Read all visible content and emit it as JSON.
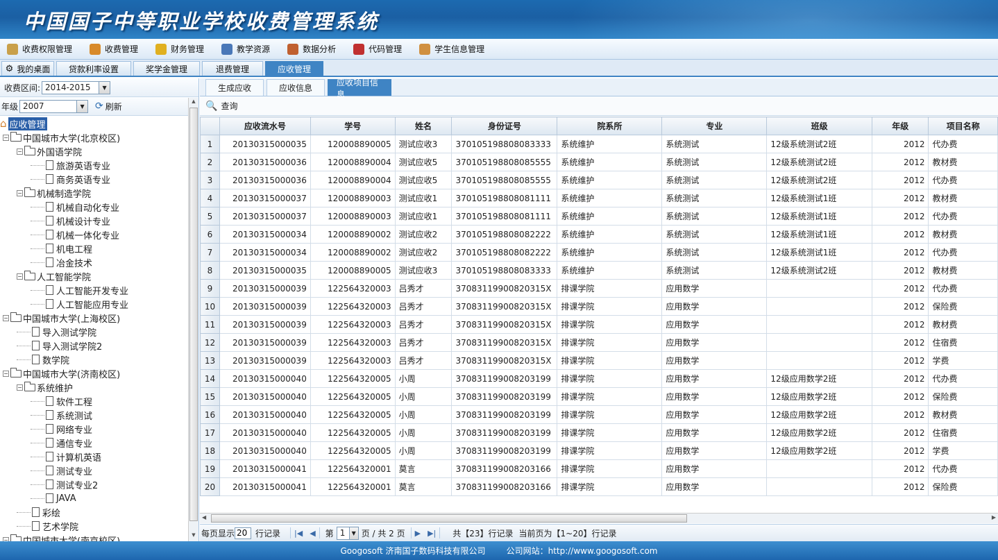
{
  "app_title": "中国国子中等职业学校收费管理系统",
  "menu": [
    {
      "label": "收费权限管理",
      "icon": "permission-icon",
      "color": "#c9a04a"
    },
    {
      "label": "收费管理",
      "icon": "fee-icon",
      "color": "#d88a2a"
    },
    {
      "label": "财务管理",
      "icon": "finance-icon",
      "color": "#e0b020"
    },
    {
      "label": "教学资源",
      "icon": "teaching-icon",
      "color": "#4a78b8"
    },
    {
      "label": "数据分析",
      "icon": "analysis-icon",
      "color": "#c06030"
    },
    {
      "label": "代码管理",
      "icon": "code-icon",
      "color": "#c03030"
    },
    {
      "label": "学生信息管理",
      "icon": "student-icon",
      "color": "#d09040"
    }
  ],
  "tabs": {
    "home": "我的桌面",
    "items": [
      "贷款利率设置",
      "奖学金管理",
      "退费管理",
      "应收管理"
    ]
  },
  "left": {
    "term_label": "收费区间:",
    "term_value": "2014-2015",
    "grade_label": "年级",
    "grade_value": "2007",
    "refresh_label": "刷新",
    "tree": [
      {
        "level": 0,
        "type": "root",
        "label": "应收管理"
      },
      {
        "level": 0,
        "type": "folder",
        "label": "中国城市大学(北京校区)"
      },
      {
        "level": 1,
        "type": "folder",
        "label": "外国语学院"
      },
      {
        "level": 2,
        "type": "leaf",
        "label": "旅游英语专业"
      },
      {
        "level": 2,
        "type": "leaf",
        "label": "商务英语专业"
      },
      {
        "level": 1,
        "type": "folder",
        "label": "机械制造学院"
      },
      {
        "level": 2,
        "type": "leaf",
        "label": "机械自动化专业"
      },
      {
        "level": 2,
        "type": "leaf",
        "label": "机械设计专业"
      },
      {
        "level": 2,
        "type": "leaf",
        "label": "机械一体化专业"
      },
      {
        "level": 2,
        "type": "leaf",
        "label": "机电工程"
      },
      {
        "level": 2,
        "type": "leaf",
        "label": "冶金技术"
      },
      {
        "level": 1,
        "type": "folder",
        "label": "人工智能学院"
      },
      {
        "level": 2,
        "type": "leaf",
        "label": "人工智能开发专业"
      },
      {
        "level": 2,
        "type": "leaf",
        "label": "人工智能应用专业"
      },
      {
        "level": 0,
        "type": "folder",
        "label": "中国城市大学(上海校区)"
      },
      {
        "level": 1,
        "type": "leaf",
        "label": "导入测试学院"
      },
      {
        "level": 1,
        "type": "leaf",
        "label": "导入测试学院2"
      },
      {
        "level": 1,
        "type": "leaf",
        "label": "数学院"
      },
      {
        "level": 0,
        "type": "folder",
        "label": "中国城市大学(济南校区)"
      },
      {
        "level": 1,
        "type": "folder",
        "label": "系统维护"
      },
      {
        "level": 2,
        "type": "leaf",
        "label": "软件工程"
      },
      {
        "level": 2,
        "type": "leaf",
        "label": "系统测试"
      },
      {
        "level": 2,
        "type": "leaf",
        "label": "网络专业"
      },
      {
        "level": 2,
        "type": "leaf",
        "label": "通信专业"
      },
      {
        "level": 2,
        "type": "leaf",
        "label": "计算机英语"
      },
      {
        "level": 2,
        "type": "leaf",
        "label": "测试专业"
      },
      {
        "level": 2,
        "type": "leaf",
        "label": "测试专业2"
      },
      {
        "level": 2,
        "type": "leaf",
        "label": "JAVA"
      },
      {
        "level": 1,
        "type": "leaf",
        "label": "彩绘"
      },
      {
        "level": 1,
        "type": "leaf",
        "label": "艺术学院"
      },
      {
        "level": 0,
        "type": "folder",
        "label": "中国城市大学(南京校区)"
      }
    ]
  },
  "subtabs": [
    "生成应收",
    "应收信息",
    "应收项目信息"
  ],
  "query_label": "查询",
  "table": {
    "columns": [
      "应收流水号",
      "学号",
      "姓名",
      "身份证号",
      "院系所",
      "专业",
      "班级",
      "年级",
      "项目名称"
    ],
    "rows": [
      [
        "1",
        "20130315000035",
        "120008890005",
        "测试应收3",
        "370105198808083333",
        "系统维护",
        "系统测试",
        "12级系统测试2班",
        "2012",
        "代办费"
      ],
      [
        "2",
        "20130315000036",
        "120008890004",
        "测试应收5",
        "370105198808085555",
        "系统维护",
        "系统测试",
        "12级系统测试2班",
        "2012",
        "教材费"
      ],
      [
        "3",
        "20130315000036",
        "120008890004",
        "测试应收5",
        "370105198808085555",
        "系统维护",
        "系统测试",
        "12级系统测试2班",
        "2012",
        "代办费"
      ],
      [
        "4",
        "20130315000037",
        "120008890003",
        "测试应收1",
        "370105198808081111",
        "系统维护",
        "系统测试",
        "12级系统测试1班",
        "2012",
        "教材费"
      ],
      [
        "5",
        "20130315000037",
        "120008890003",
        "测试应收1",
        "370105198808081111",
        "系统维护",
        "系统测试",
        "12级系统测试1班",
        "2012",
        "代办费"
      ],
      [
        "6",
        "20130315000034",
        "120008890002",
        "测试应收2",
        "370105198808082222",
        "系统维护",
        "系统测试",
        "12级系统测试1班",
        "2012",
        "教材费"
      ],
      [
        "7",
        "20130315000034",
        "120008890002",
        "测试应收2",
        "370105198808082222",
        "系统维护",
        "系统测试",
        "12级系统测试1班",
        "2012",
        "代办费"
      ],
      [
        "8",
        "20130315000035",
        "120008890005",
        "测试应收3",
        "370105198808083333",
        "系统维护",
        "系统测试",
        "12级系统测试2班",
        "2012",
        "教材费"
      ],
      [
        "9",
        "20130315000039",
        "122564320003",
        "吕秀才",
        "37083119900820315X",
        "排课学院",
        "应用数学",
        "",
        "2012",
        "代办费"
      ],
      [
        "10",
        "20130315000039",
        "122564320003",
        "吕秀才",
        "37083119900820315X",
        "排课学院",
        "应用数学",
        "",
        "2012",
        "保险费"
      ],
      [
        "11",
        "20130315000039",
        "122564320003",
        "吕秀才",
        "37083119900820315X",
        "排课学院",
        "应用数学",
        "",
        "2012",
        "教材费"
      ],
      [
        "12",
        "20130315000039",
        "122564320003",
        "吕秀才",
        "37083119900820315X",
        "排课学院",
        "应用数学",
        "",
        "2012",
        "住宿费"
      ],
      [
        "13",
        "20130315000039",
        "122564320003",
        "吕秀才",
        "37083119900820315X",
        "排课学院",
        "应用数学",
        "",
        "2012",
        "学费"
      ],
      [
        "14",
        "20130315000040",
        "122564320005",
        "小周",
        "370831199008203199",
        "排课学院",
        "应用数学",
        "12级应用数学2班",
        "2012",
        "代办费"
      ],
      [
        "15",
        "20130315000040",
        "122564320005",
        "小周",
        "370831199008203199",
        "排课学院",
        "应用数学",
        "12级应用数学2班",
        "2012",
        "保险费"
      ],
      [
        "16",
        "20130315000040",
        "122564320005",
        "小周",
        "370831199008203199",
        "排课学院",
        "应用数学",
        "12级应用数学2班",
        "2012",
        "教材费"
      ],
      [
        "17",
        "20130315000040",
        "122564320005",
        "小周",
        "370831199008203199",
        "排课学院",
        "应用数学",
        "12级应用数学2班",
        "2012",
        "住宿费"
      ],
      [
        "18",
        "20130315000040",
        "122564320005",
        "小周",
        "370831199008203199",
        "排课学院",
        "应用数学",
        "12级应用数学2班",
        "2012",
        "学费"
      ],
      [
        "19",
        "20130315000041",
        "122564320001",
        "莫言",
        "370831199008203166",
        "排课学院",
        "应用数学",
        "",
        "2012",
        "代办费"
      ],
      [
        "20",
        "20130315000041",
        "122564320001",
        "莫言",
        "370831199008203166",
        "排课学院",
        "应用数学",
        "",
        "2012",
        "保险费"
      ]
    ]
  },
  "pager": {
    "per_page_label": "每页显示",
    "per_page_value": "20",
    "records_unit": "行记录",
    "page_prefix": "第",
    "page_value": "1",
    "page_of": "页 / 共 2 页",
    "total_text": "共【23】行记录",
    "range_text": "当前页为【1~20】行记录"
  },
  "footer": {
    "company": "Googosoft 济南国子数码科技有限公司",
    "website": "公司网站：http://www.googosoft.com"
  }
}
